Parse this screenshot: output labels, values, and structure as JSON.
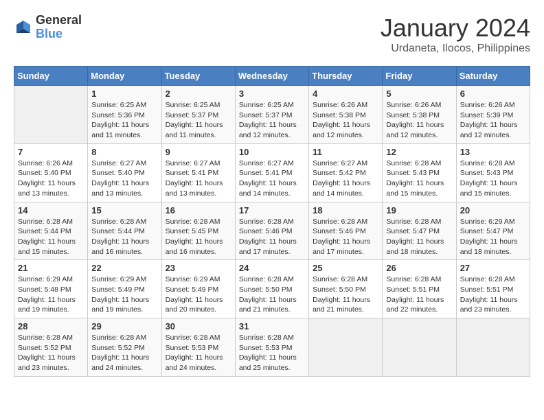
{
  "header": {
    "logo_general": "General",
    "logo_blue": "Blue",
    "month": "January 2024",
    "location": "Urdaneta, Ilocos, Philippines"
  },
  "weekdays": [
    "Sunday",
    "Monday",
    "Tuesday",
    "Wednesday",
    "Thursday",
    "Friday",
    "Saturday"
  ],
  "weeks": [
    [
      {
        "day": "",
        "info": ""
      },
      {
        "day": "1",
        "info": "Sunrise: 6:25 AM\nSunset: 5:36 PM\nDaylight: 11 hours and 11 minutes."
      },
      {
        "day": "2",
        "info": "Sunrise: 6:25 AM\nSunset: 5:37 PM\nDaylight: 11 hours and 11 minutes."
      },
      {
        "day": "3",
        "info": "Sunrise: 6:25 AM\nSunset: 5:37 PM\nDaylight: 11 hours and 12 minutes."
      },
      {
        "day": "4",
        "info": "Sunrise: 6:26 AM\nSunset: 5:38 PM\nDaylight: 11 hours and 12 minutes."
      },
      {
        "day": "5",
        "info": "Sunrise: 6:26 AM\nSunset: 5:38 PM\nDaylight: 11 hours and 12 minutes."
      },
      {
        "day": "6",
        "info": "Sunrise: 6:26 AM\nSunset: 5:39 PM\nDaylight: 11 hours and 12 minutes."
      }
    ],
    [
      {
        "day": "7",
        "info": "Sunrise: 6:26 AM\nSunset: 5:40 PM\nDaylight: 11 hours and 13 minutes."
      },
      {
        "day": "8",
        "info": "Sunrise: 6:27 AM\nSunset: 5:40 PM\nDaylight: 11 hours and 13 minutes."
      },
      {
        "day": "9",
        "info": "Sunrise: 6:27 AM\nSunset: 5:41 PM\nDaylight: 11 hours and 13 minutes."
      },
      {
        "day": "10",
        "info": "Sunrise: 6:27 AM\nSunset: 5:41 PM\nDaylight: 11 hours and 14 minutes."
      },
      {
        "day": "11",
        "info": "Sunrise: 6:27 AM\nSunset: 5:42 PM\nDaylight: 11 hours and 14 minutes."
      },
      {
        "day": "12",
        "info": "Sunrise: 6:28 AM\nSunset: 5:43 PM\nDaylight: 11 hours and 15 minutes."
      },
      {
        "day": "13",
        "info": "Sunrise: 6:28 AM\nSunset: 5:43 PM\nDaylight: 11 hours and 15 minutes."
      }
    ],
    [
      {
        "day": "14",
        "info": "Sunrise: 6:28 AM\nSunset: 5:44 PM\nDaylight: 11 hours and 15 minutes."
      },
      {
        "day": "15",
        "info": "Sunrise: 6:28 AM\nSunset: 5:44 PM\nDaylight: 11 hours and 16 minutes."
      },
      {
        "day": "16",
        "info": "Sunrise: 6:28 AM\nSunset: 5:45 PM\nDaylight: 11 hours and 16 minutes."
      },
      {
        "day": "17",
        "info": "Sunrise: 6:28 AM\nSunset: 5:46 PM\nDaylight: 11 hours and 17 minutes."
      },
      {
        "day": "18",
        "info": "Sunrise: 6:28 AM\nSunset: 5:46 PM\nDaylight: 11 hours and 17 minutes."
      },
      {
        "day": "19",
        "info": "Sunrise: 6:28 AM\nSunset: 5:47 PM\nDaylight: 11 hours and 18 minutes."
      },
      {
        "day": "20",
        "info": "Sunrise: 6:29 AM\nSunset: 5:47 PM\nDaylight: 11 hours and 18 minutes."
      }
    ],
    [
      {
        "day": "21",
        "info": "Sunrise: 6:29 AM\nSunset: 5:48 PM\nDaylight: 11 hours and 19 minutes."
      },
      {
        "day": "22",
        "info": "Sunrise: 6:29 AM\nSunset: 5:49 PM\nDaylight: 11 hours and 19 minutes."
      },
      {
        "day": "23",
        "info": "Sunrise: 6:29 AM\nSunset: 5:49 PM\nDaylight: 11 hours and 20 minutes."
      },
      {
        "day": "24",
        "info": "Sunrise: 6:28 AM\nSunset: 5:50 PM\nDaylight: 11 hours and 21 minutes."
      },
      {
        "day": "25",
        "info": "Sunrise: 6:28 AM\nSunset: 5:50 PM\nDaylight: 11 hours and 21 minutes."
      },
      {
        "day": "26",
        "info": "Sunrise: 6:28 AM\nSunset: 5:51 PM\nDaylight: 11 hours and 22 minutes."
      },
      {
        "day": "27",
        "info": "Sunrise: 6:28 AM\nSunset: 5:51 PM\nDaylight: 11 hours and 23 minutes."
      }
    ],
    [
      {
        "day": "28",
        "info": "Sunrise: 6:28 AM\nSunset: 5:52 PM\nDaylight: 11 hours and 23 minutes."
      },
      {
        "day": "29",
        "info": "Sunrise: 6:28 AM\nSunset: 5:52 PM\nDaylight: 11 hours and 24 minutes."
      },
      {
        "day": "30",
        "info": "Sunrise: 6:28 AM\nSunset: 5:53 PM\nDaylight: 11 hours and 24 minutes."
      },
      {
        "day": "31",
        "info": "Sunrise: 6:28 AM\nSunset: 5:53 PM\nDaylight: 11 hours and 25 minutes."
      },
      {
        "day": "",
        "info": ""
      },
      {
        "day": "",
        "info": ""
      },
      {
        "day": "",
        "info": ""
      }
    ]
  ]
}
